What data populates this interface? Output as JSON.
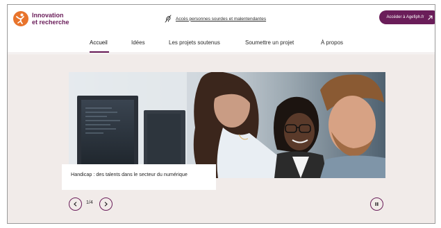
{
  "header": {
    "brand_line1": "Innovation",
    "brand_line2": "et recherche",
    "accessibility_link": "Accès personnes sourdes et malentendantes",
    "cta_label": "Accéder à Agefiph.fr"
  },
  "nav": {
    "items": [
      {
        "label": "Accueil",
        "active": true
      },
      {
        "label": "Idées",
        "active": false
      },
      {
        "label": "Les projets soutenus",
        "active": false
      },
      {
        "label": "Soumettre un projet",
        "active": false
      },
      {
        "label": "À propos",
        "active": false
      }
    ]
  },
  "carousel": {
    "caption": "Handicap : des talents dans le secteur du numérique",
    "counter": "1/4"
  },
  "colors": {
    "brand": "#6a1d59",
    "logo": "#e8742c",
    "stage_bg": "#f1ebe9"
  },
  "icons": {
    "logo": "agefiph-figure-icon",
    "accessibility": "ear-icon",
    "cta": "external-arrow-icon",
    "prev": "chevron-left-icon",
    "next": "chevron-right-icon",
    "pause": "pause-icon"
  }
}
